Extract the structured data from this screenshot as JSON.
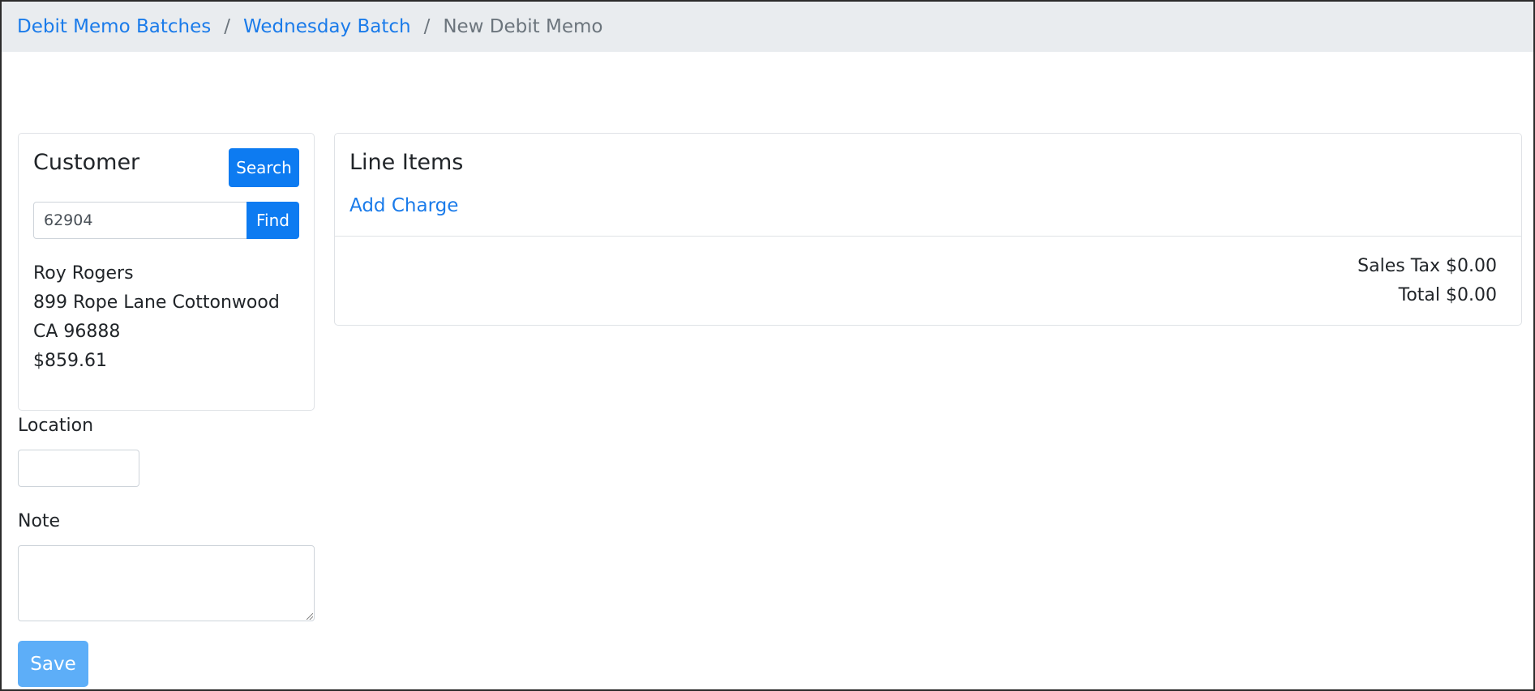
{
  "breadcrumb": {
    "items": [
      "Debit Memo Batches",
      "Wednesday Batch"
    ],
    "separator": "/",
    "current": "New Debit Memo"
  },
  "customer": {
    "title": "Customer",
    "search_label": "Search",
    "id_value": "62904",
    "find_label": "Find",
    "name": "Roy Rogers",
    "address_line1": "899 Rope Lane Cottonwood",
    "address_line2": "CA 96888",
    "balance": "$859.61"
  },
  "location": {
    "label": "Location",
    "value": ""
  },
  "note": {
    "label": "Note",
    "value": ""
  },
  "save_label": "Save",
  "line_items": {
    "title": "Line Items",
    "add_charge_label": "Add Charge",
    "sales_tax": "Sales Tax $0.00",
    "total": "Total $0.00"
  },
  "colors": {
    "primary": "#0d7bf1",
    "link": "#1a7bea",
    "disabled_primary": "#5daef8",
    "breadcrumb_bg": "#e9ecef"
  }
}
